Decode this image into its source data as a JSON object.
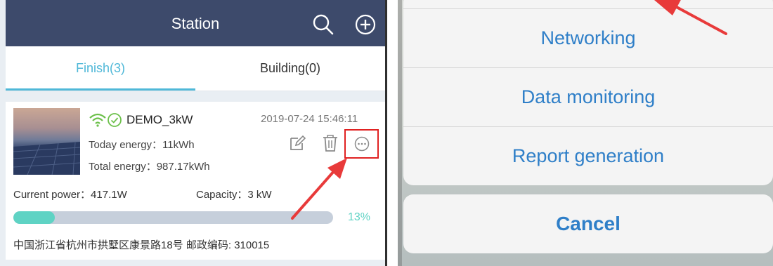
{
  "left_screen": {
    "header": {
      "title": "Station",
      "icons": [
        "search-icon",
        "add-circle-icon"
      ]
    },
    "tabs": [
      {
        "label": "Finish(3)",
        "active": true
      },
      {
        "label": "Building(0)",
        "active": false
      }
    ],
    "station_card": {
      "name": "DEMO_3kW",
      "datetime": "2019-07-24 15:46:11",
      "today_energy": "Today energy：11kWh",
      "total_energy": "Total energy：987.17kWh",
      "current_power": "Current power：417.1W",
      "capacity": "Capacity：3 kW",
      "progress_percent": 13,
      "progress_label": "13%",
      "address": "中国浙江省杭州市拱墅区康景路18号 邮政编码: 310015",
      "status_icons": [
        "wifi-icon",
        "check-circle-icon"
      ],
      "action_icons": [
        "edit-icon",
        "trash-icon",
        "more-icon"
      ]
    }
  },
  "right_screen": {
    "action_sheet": {
      "items": [
        "Networking",
        "Data monitoring",
        "Report generation"
      ],
      "cancel_label": "Cancel"
    }
  },
  "colors": {
    "header_bg": "#3d4a6b",
    "accent": "#4fb8d8",
    "progress": "#5fd3c4",
    "highlight_red": "#e02222",
    "sheet_text": "#2f7fc8"
  }
}
